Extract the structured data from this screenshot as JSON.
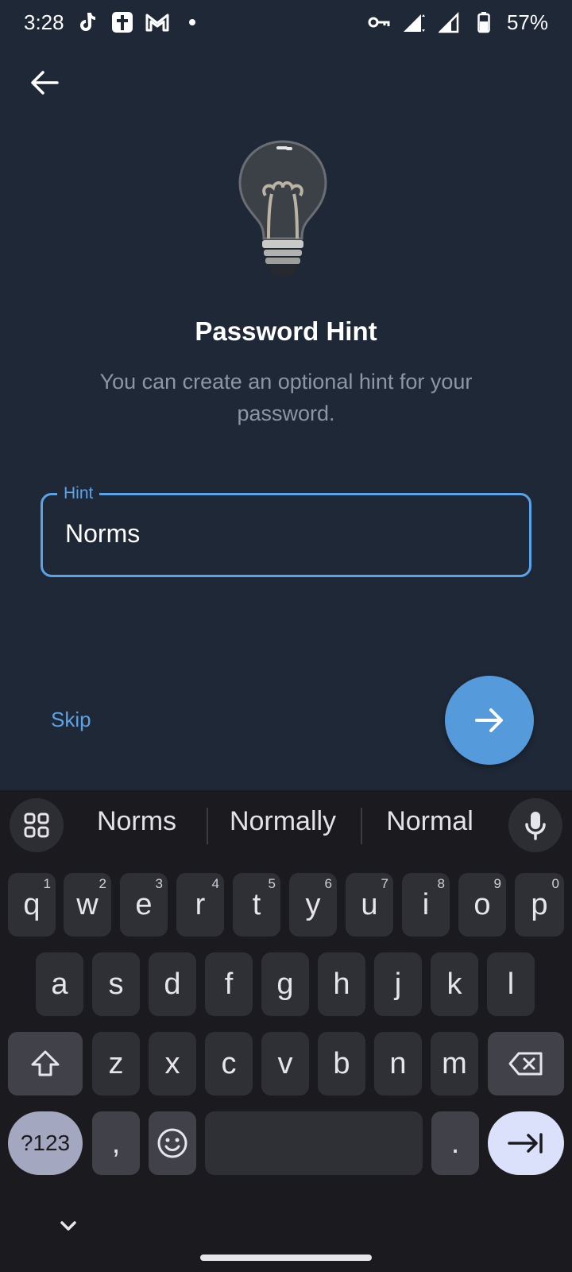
{
  "status_bar": {
    "time": "3:28",
    "battery": "57%",
    "icons": [
      "tiktok-icon",
      "cross-app-icon",
      "gmail-icon",
      "notification-dot",
      "vpn-key-icon",
      "signal-icon",
      "signal-icon",
      "battery-icon"
    ]
  },
  "screen": {
    "title": "Password Hint",
    "subtitle": "You can create an optional hint for your password.",
    "hint_field": {
      "label": "Hint",
      "value": "Norms"
    },
    "skip_label": "Skip",
    "colors": {
      "background": "#1f2836",
      "accent": "#5aa3e6",
      "next_button": "#559bdc"
    }
  },
  "keyboard": {
    "suggestions": [
      "Norms",
      "Normally",
      "Normal"
    ],
    "row1": [
      {
        "k": "q",
        "s": "1"
      },
      {
        "k": "w",
        "s": "2"
      },
      {
        "k": "e",
        "s": "3"
      },
      {
        "k": "r",
        "s": "4"
      },
      {
        "k": "t",
        "s": "5"
      },
      {
        "k": "y",
        "s": "6"
      },
      {
        "k": "u",
        "s": "7"
      },
      {
        "k": "i",
        "s": "8"
      },
      {
        "k": "o",
        "s": "9"
      },
      {
        "k": "p",
        "s": "0"
      }
    ],
    "row2": [
      "a",
      "s",
      "d",
      "f",
      "g",
      "h",
      "j",
      "k",
      "l"
    ],
    "row3": [
      "z",
      "x",
      "c",
      "v",
      "b",
      "n",
      "m"
    ],
    "symbols_label": "?123",
    "comma": ",",
    "period": "."
  }
}
